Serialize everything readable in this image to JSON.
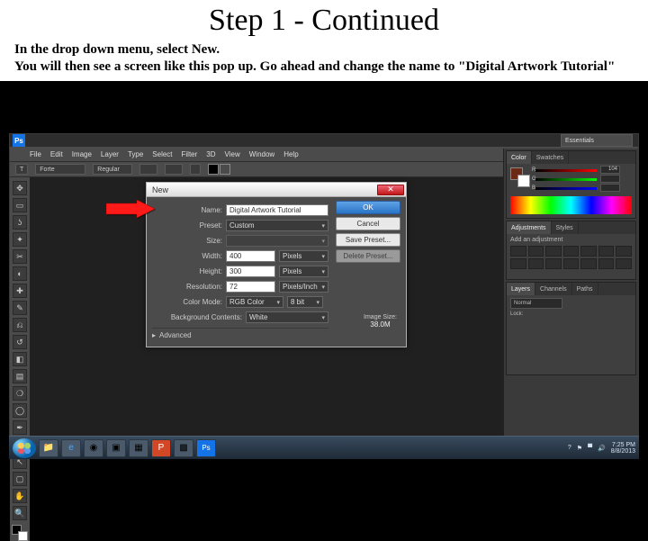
{
  "slide": {
    "title": "Step 1 - Continued",
    "line1": "In the drop down menu, select New.",
    "line2": "You will then see a screen like this pop up. Go ahead and change the name to \"Digital Artwork Tutorial\""
  },
  "photoshop": {
    "logo": "Ps",
    "menu": [
      "File",
      "Edit",
      "Image",
      "Layer",
      "Type",
      "Select",
      "Filter",
      "3D",
      "View",
      "Window",
      "Help"
    ],
    "options": {
      "font": "Forte",
      "style": "Regular",
      "swatch_fg": "#000000",
      "swatch_stroke": "#18d8c8"
    },
    "workspace": "Essentials",
    "panels": {
      "color": {
        "tabs": [
          "Color",
          "Swatches"
        ],
        "r": "104",
        "g": "",
        "b": "",
        "fg": "#6a2a16"
      },
      "adjust": {
        "tabs": [
          "Adjustments",
          "Styles"
        ],
        "hint": "Add an adjustment"
      },
      "layers": {
        "tabs": [
          "Layers",
          "Channels",
          "Paths"
        ],
        "blend": "Normal",
        "lock": "Lock:"
      }
    }
  },
  "dialog": {
    "title": "New",
    "fields": {
      "name_label": "Name:",
      "name_value": "Digital Artwork Tutorial",
      "preset_label": "Preset:",
      "preset_value": "Custom",
      "size_label": "Size:",
      "size_value": "",
      "width_label": "Width:",
      "width_value": "400",
      "width_unit": "Pixels",
      "height_label": "Height:",
      "height_value": "300",
      "height_unit": "Pixels",
      "res_label": "Resolution:",
      "res_value": "72",
      "res_unit": "Pixels/Inch",
      "mode_label": "Color Mode:",
      "mode_value": "RGB Color",
      "mode_bits": "8 bit",
      "bg_label": "Background Contents:",
      "bg_value": "White",
      "advanced": "Advanced"
    },
    "buttons": {
      "ok": "OK",
      "cancel": "Cancel",
      "save": "Save Preset...",
      "delete": "Delete Preset..."
    },
    "imgsize": {
      "label": "Image Size:",
      "value": "38.0M"
    }
  },
  "taskbar": {
    "time": "7:25 PM",
    "date": "8/8/2013"
  }
}
